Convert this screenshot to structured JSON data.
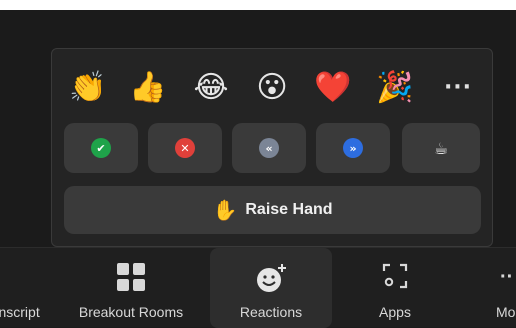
{
  "reactions_panel": {
    "emojis": [
      {
        "name": "clapping-hands",
        "glyph": "👏"
      },
      {
        "name": "thumbs-up",
        "glyph": "👍"
      },
      {
        "name": "tears-of-joy",
        "glyph": "😂"
      },
      {
        "name": "open-mouth",
        "glyph": "😮"
      },
      {
        "name": "red-heart",
        "glyph": "❤️"
      },
      {
        "name": "party-popper",
        "glyph": "🎉"
      }
    ],
    "more_label": "···",
    "status_buttons": [
      {
        "name": "yes",
        "glyph": "✔",
        "color": "#1fa34a"
      },
      {
        "name": "no",
        "glyph": "✕",
        "color": "#e0403a"
      },
      {
        "name": "slow-down",
        "glyph": "«",
        "color": "#7b8596"
      },
      {
        "name": "speed-up",
        "glyph": "»",
        "color": "#2d6de0"
      },
      {
        "name": "coffee",
        "glyph": "☕",
        "color": "#f0f0f0"
      }
    ],
    "raise_hand": {
      "icon": "✋",
      "label": "Raise Hand"
    }
  },
  "toolbar": {
    "items": [
      {
        "label": "Transcript"
      },
      {
        "label": "Breakout Rooms"
      },
      {
        "label": "Reactions"
      },
      {
        "label": "Apps"
      },
      {
        "label": "More"
      }
    ]
  },
  "colors": {
    "background": "#1b1b1b",
    "panel": "#242424",
    "button": "#3a3a3a",
    "raise_hand_icon": "#f5b800"
  }
}
